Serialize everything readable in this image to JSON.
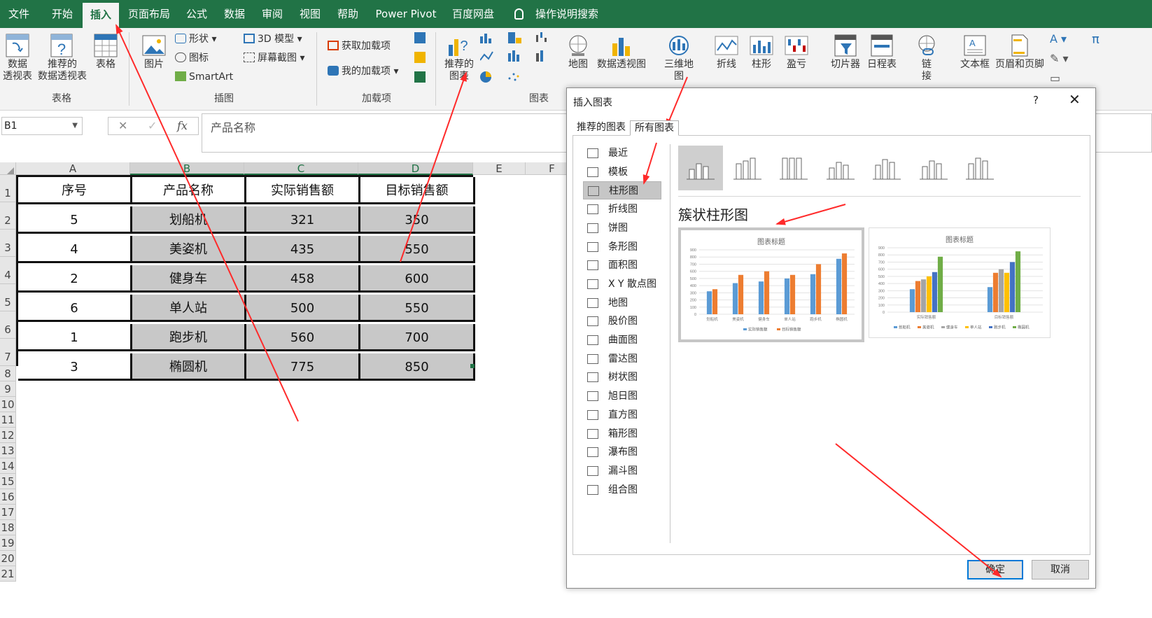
{
  "ribbon_tabs": [
    "文件",
    "开始",
    "插入",
    "页面布局",
    "公式",
    "数据",
    "审阅",
    "视图",
    "帮助",
    "Power Pivot",
    "百度网盘"
  ],
  "active_tab": "插入",
  "tell_me": "操作说明搜索",
  "ribbon": {
    "pivot_table": "数据\n透视表",
    "recommended_pivot": "推荐的\n数据透视表",
    "table": "表格",
    "group_tables": "表格",
    "pictures": "图片",
    "shapes": "形状",
    "icons": "图标",
    "smartart": "SmartArt",
    "model_3d": "3D 模型",
    "screenshot": "屏幕截图",
    "group_illustrations": "插图",
    "get_addins": "获取加载项",
    "my_addins": "我的加载项",
    "group_addins": "加载项",
    "recommended_charts": "推荐的\n图表",
    "group_charts": "图表",
    "maps": "地图",
    "pivot_chart": "数据透视图",
    "map_3d": "三维地\n图",
    "sparkline_line": "折线",
    "sparkline_column": "柱形",
    "sparkline_winloss": "盈亏",
    "slicer": "切片器",
    "timeline": "日程表",
    "link": "链\n接",
    "textbox": "文本框",
    "header_footer": "页眉和页脚"
  },
  "formula_bar": {
    "name_box": "B1",
    "content": "产品名称"
  },
  "columns": [
    "A",
    "B",
    "C",
    "D",
    "E",
    "F"
  ],
  "rows": [
    "1",
    "2",
    "3",
    "4",
    "5",
    "6",
    "7",
    "8",
    "9",
    "10",
    "11",
    "12",
    "13",
    "14",
    "15",
    "16",
    "17",
    "18",
    "19",
    "20",
    "21"
  ],
  "table": {
    "headers": [
      "序号",
      "产品名称",
      "实际销售额",
      "目标销售额"
    ],
    "rows": [
      [
        "5",
        "划船机",
        "321",
        "350"
      ],
      [
        "4",
        "美姿机",
        "435",
        "550"
      ],
      [
        "2",
        "健身车",
        "458",
        "600"
      ],
      [
        "6",
        "单人站",
        "500",
        "550"
      ],
      [
        "1",
        "跑步机",
        "560",
        "700"
      ],
      [
        "3",
        "椭圆机",
        "775",
        "850"
      ]
    ]
  },
  "dialog": {
    "title": "插入图表",
    "help": "?",
    "tabs": [
      "推荐的图表",
      "所有图表"
    ],
    "active_tab": "所有图表",
    "categories": [
      "最近",
      "模板",
      "柱形图",
      "折线图",
      "饼图",
      "条形图",
      "面积图",
      "X Y 散点图",
      "地图",
      "股价图",
      "曲面图",
      "雷达图",
      "树状图",
      "旭日图",
      "直方图",
      "箱形图",
      "瀑布图",
      "漏斗图",
      "组合图"
    ],
    "selected_category": "柱形图",
    "subtype_name": "簇状柱形图",
    "preview_title": "图表标题",
    "ok": "确定",
    "cancel": "取消"
  },
  "chart_data": [
    {
      "type": "bar",
      "title": "图表标题",
      "categories": [
        "划船机",
        "美姿机",
        "健身车",
        "单人站",
        "跑步机",
        "椭圆机"
      ],
      "series": [
        {
          "name": "实际销售额",
          "values": [
            321,
            435,
            458,
            500,
            560,
            775
          ],
          "color": "#5b9bd5"
        },
        {
          "name": "目标销售额",
          "values": [
            350,
            550,
            600,
            550,
            700,
            850
          ],
          "color": "#ed7d31"
        }
      ],
      "ylim": [
        0,
        900
      ],
      "yticks": [
        "0",
        "100",
        "200",
        "300",
        "400",
        "500",
        "600",
        "700",
        "800",
        "900"
      ],
      "grid": true,
      "legend": "bottom"
    },
    {
      "type": "bar",
      "title": "图表标题",
      "categories": [
        "实际销售额",
        "目标销售额"
      ],
      "series": [
        {
          "name": "划船机",
          "values": [
            321,
            350
          ],
          "color": "#5b9bd5"
        },
        {
          "name": "美姿机",
          "values": [
            435,
            550
          ],
          "color": "#ed7d31"
        },
        {
          "name": "健身车",
          "values": [
            458,
            600
          ],
          "color": "#a5a5a5"
        },
        {
          "name": "单人站",
          "values": [
            500,
            550
          ],
          "color": "#ffc000"
        },
        {
          "name": "跑步机",
          "values": [
            560,
            700
          ],
          "color": "#4472c4"
        },
        {
          "name": "椭圆机",
          "values": [
            775,
            850
          ],
          "color": "#70ad47"
        }
      ],
      "ylim": [
        0,
        900
      ],
      "yticks": [
        "0",
        "100",
        "200",
        "300",
        "400",
        "500",
        "600",
        "700",
        "800",
        "900"
      ],
      "grid": true,
      "legend": "bottom"
    }
  ],
  "colors": {
    "excel_green": "#217346",
    "annotation_red": "#ff2a2a",
    "selection_grey": "#c8c8c8"
  }
}
